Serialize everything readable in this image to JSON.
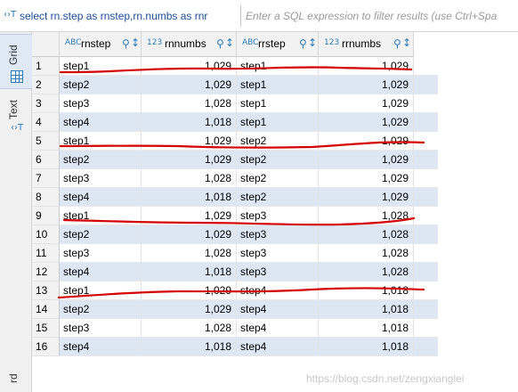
{
  "filter": {
    "icon": "sql-icon",
    "sql": "select rn.step as rnstep,rn.numbs as rnr",
    "placeholder": "Enter a SQL expression to filter results (use Ctrl+Spa"
  },
  "tabs": {
    "grid_label": "Grid",
    "text_label": "Text",
    "bottom_label": "rd"
  },
  "columns": [
    {
      "type": "ABC",
      "name": "rnstep"
    },
    {
      "type": "123",
      "name": "rnnumbs"
    },
    {
      "type": "ABC",
      "name": "rrstep"
    },
    {
      "type": "123",
      "name": "rrnumbs"
    }
  ],
  "rows": [
    {
      "n": "1",
      "rnstep": "step1",
      "rnnumbs": "1,029",
      "rrstep": "step1",
      "rrnumbs": "1,029"
    },
    {
      "n": "2",
      "rnstep": "step2",
      "rnnumbs": "1,029",
      "rrstep": "step1",
      "rrnumbs": "1,029"
    },
    {
      "n": "3",
      "rnstep": "step3",
      "rnnumbs": "1,028",
      "rrstep": "step1",
      "rrnumbs": "1,029"
    },
    {
      "n": "4",
      "rnstep": "step4",
      "rnnumbs": "1,018",
      "rrstep": "step1",
      "rrnumbs": "1,029"
    },
    {
      "n": "5",
      "rnstep": "step1",
      "rnnumbs": "1,029",
      "rrstep": "step2",
      "rrnumbs": "1,029"
    },
    {
      "n": "6",
      "rnstep": "step2",
      "rnnumbs": "1,029",
      "rrstep": "step2",
      "rrnumbs": "1,029"
    },
    {
      "n": "7",
      "rnstep": "step3",
      "rnnumbs": "1,028",
      "rrstep": "step2",
      "rrnumbs": "1,029"
    },
    {
      "n": "8",
      "rnstep": "step4",
      "rnnumbs": "1,018",
      "rrstep": "step2",
      "rrnumbs": "1,029"
    },
    {
      "n": "9",
      "rnstep": "step1",
      "rnnumbs": "1,029",
      "rrstep": "step3",
      "rrnumbs": "1,028"
    },
    {
      "n": "10",
      "rnstep": "step2",
      "rnnumbs": "1,029",
      "rrstep": "step3",
      "rrnumbs": "1,028"
    },
    {
      "n": "11",
      "rnstep": "step3",
      "rnnumbs": "1,028",
      "rrstep": "step3",
      "rrnumbs": "1,028"
    },
    {
      "n": "12",
      "rnstep": "step4",
      "rnnumbs": "1,018",
      "rrstep": "step3",
      "rrnumbs": "1,028"
    },
    {
      "n": "13",
      "rnstep": "step1",
      "rnnumbs": "1,029",
      "rrstep": "step4",
      "rrnumbs": "1,018"
    },
    {
      "n": "14",
      "rnstep": "step2",
      "rnnumbs": "1,029",
      "rrstep": "step4",
      "rrnumbs": "1,018"
    },
    {
      "n": "15",
      "rnstep": "step3",
      "rnnumbs": "1,028",
      "rrstep": "step4",
      "rrnumbs": "1,018"
    },
    {
      "n": "16",
      "rnstep": "step4",
      "rnnumbs": "1,018",
      "rrstep": "step4",
      "rrnumbs": "1,018"
    }
  ],
  "annotation_rows": [
    "1",
    "5",
    "9",
    "13"
  ],
  "watermark": "https://blog.csdn.net/zengxianglei",
  "colors": {
    "accent": "#2a7ab8",
    "alt_row": "#dde6f3",
    "annotation": "#d40000"
  }
}
